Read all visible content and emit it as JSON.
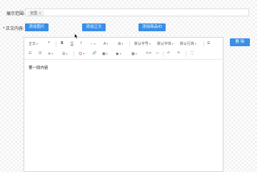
{
  "form": {
    "range_label": "展示范围:",
    "range_tag": "全国",
    "range_tag_close": "×",
    "content_required": "*",
    "content_label": "正文内容:",
    "buttons": {
      "add_image": "添加图片",
      "add_text": "添加正文",
      "add_product_id": "添加商品ID",
      "delete": "删 除"
    }
  },
  "toolbar": {
    "row1": [
      "正文",
      "❝",
      "B",
      "U",
      "I",
      "···",
      "A",
      "⊞",
      "默认字号",
      "默认字体",
      "默认行高",
      "☰"
    ],
    "row2": [
      "☷",
      "☑",
      "≡",
      "☰",
      "☺",
      "🔗",
      "▣",
      "▶",
      "▦",
      "<>",
      "—",
      "↶",
      "↷",
      "⛶"
    ]
  },
  "editor": {
    "content": "第一段内容"
  },
  "colors": {
    "button_bg": "#3a8ee6",
    "required": "#e53935"
  }
}
